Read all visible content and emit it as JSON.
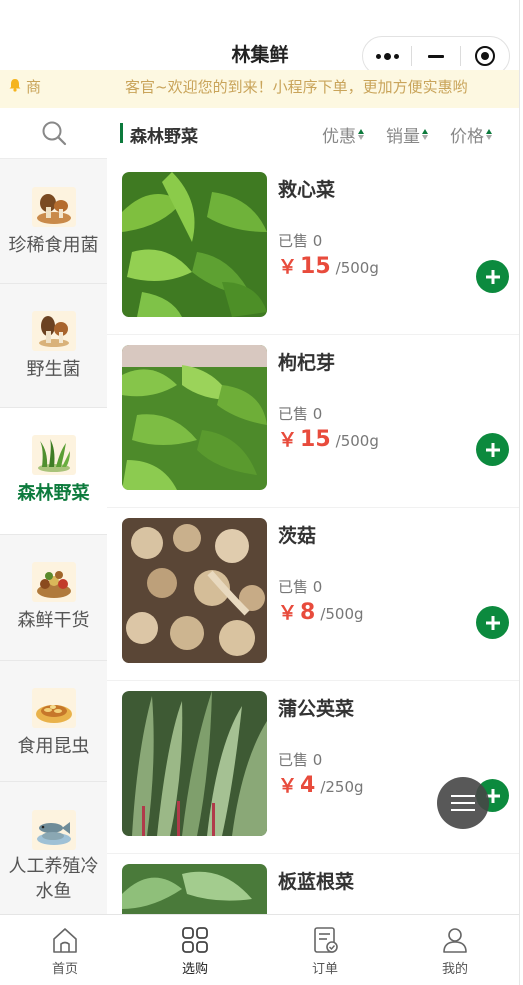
{
  "app": {
    "title": "林集鲜"
  },
  "notice": {
    "label": "商",
    "text": "客官~欢迎您的到来！小程序下单，更加方便实惠哟"
  },
  "sidebar": {
    "categories": [
      {
        "label": "珍稀食用菌",
        "icon": "mushroom-basket-icon"
      },
      {
        "label": "野生菌",
        "icon": "wild-mushroom-icon"
      },
      {
        "label": "森林野菜",
        "icon": "wild-greens-icon",
        "active": true
      },
      {
        "label": "森鲜干货",
        "icon": "dried-goods-icon"
      },
      {
        "label": "食用昆虫",
        "icon": "insect-dish-icon"
      },
      {
        "label": "人工养殖冷水鱼",
        "icon": "fish-icon"
      }
    ]
  },
  "section": {
    "title": "森林野菜",
    "sorts": [
      "优惠",
      "销量",
      "价格"
    ]
  },
  "products": [
    {
      "name": "救心菜",
      "sold": "已售 0",
      "currency": "￥",
      "price": "15",
      "unit": "/500g"
    },
    {
      "name": "枸杞芽",
      "sold": "已售 0",
      "currency": "￥",
      "price": "15",
      "unit": "/500g"
    },
    {
      "name": "茨菇",
      "sold": "已售 0",
      "currency": "￥",
      "price": "8",
      "unit": "/500g"
    },
    {
      "name": "蒲公英菜",
      "sold": "已售 0",
      "currency": "￥",
      "price": "4",
      "unit": "/250g"
    },
    {
      "name": "板蓝根菜",
      "sold": "",
      "currency": "",
      "price": "",
      "unit": ""
    }
  ],
  "tabbar": {
    "tabs": [
      {
        "label": "首页",
        "icon": "home-icon"
      },
      {
        "label": "选购",
        "icon": "grid-icon",
        "active": true
      },
      {
        "label": "订单",
        "icon": "order-icon"
      },
      {
        "label": "我的",
        "icon": "user-icon"
      }
    ]
  },
  "colors": {
    "accent": "#0c7a3c",
    "price": "#e84b3c",
    "notice_bg": "#fdf8e1",
    "notice_text": "#c9a45a"
  }
}
